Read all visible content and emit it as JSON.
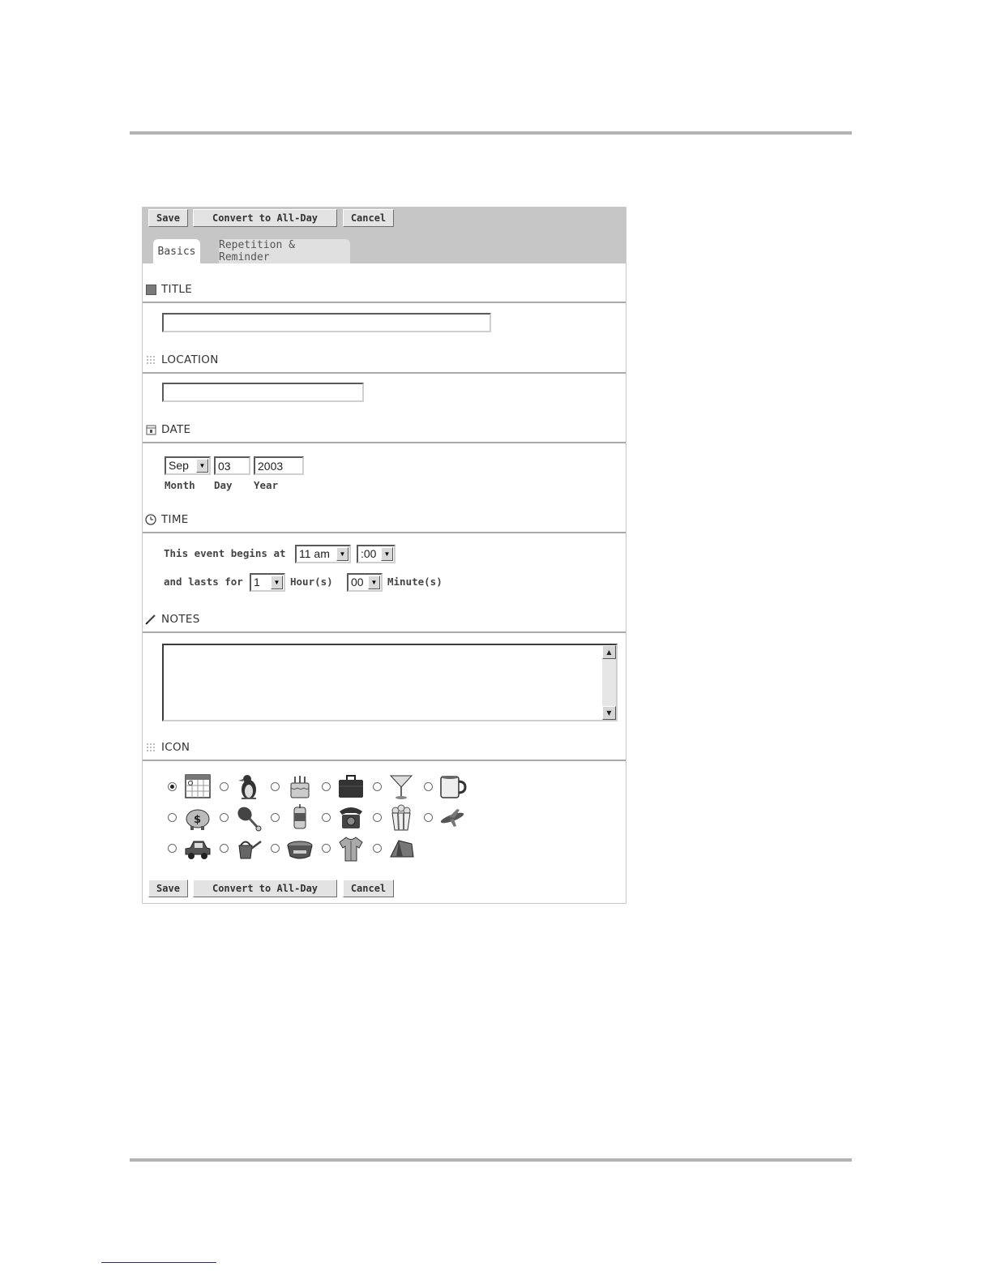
{
  "toolbar": {
    "save_label": "Save",
    "convert_label": "Convert to All-Day",
    "cancel_label": "Cancel"
  },
  "tabs": [
    {
      "label": "Basics",
      "active": true
    },
    {
      "label": "Repetition & Reminder",
      "active": false
    }
  ],
  "sections": {
    "title": {
      "heading": "TITLE",
      "value": ""
    },
    "location": {
      "heading": "LOCATION",
      "value": ""
    },
    "date": {
      "heading": "DATE",
      "month": "Sep",
      "day": "03",
      "year": "2003",
      "month_label": "Month",
      "day_label": "Day",
      "year_label": "Year"
    },
    "time": {
      "heading": "TIME",
      "begins_label": "This event begins at",
      "hour": "11 am",
      "minute": ":00",
      "lasts_label": "and lasts for",
      "duration_hours": "1",
      "hours_label": "Hour(s)",
      "duration_minutes": "00",
      "minutes_label": "Minute(s)"
    },
    "notes": {
      "heading": "NOTES",
      "value": ""
    },
    "icon": {
      "heading": "ICON",
      "selected": "calendar-icon",
      "options": [
        "calendar-icon",
        "penguin-icon",
        "birthday-cake-icon",
        "briefcase-icon",
        "martini-icon",
        "coffee-mug-icon",
        "piggy-bank-icon",
        "drumstick-icon",
        "soda-can-icon",
        "telephone-icon",
        "popcorn-icon",
        "airplane-icon",
        "car-icon",
        "watering-can-icon",
        "pet-bowl-icon",
        "shirt-icon",
        "tent-icon"
      ]
    }
  },
  "colors": {
    "toolbar_bg": "#c6c6c6",
    "tab_inactive": "#e0e0e0",
    "rule": "#a9a9a9"
  }
}
